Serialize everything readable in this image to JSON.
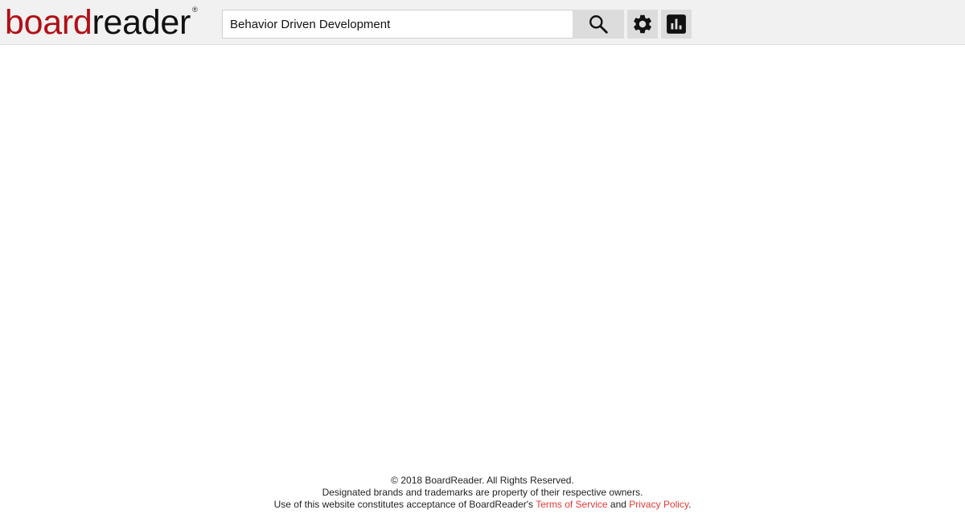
{
  "logo": {
    "part1": "board",
    "part2": "reader",
    "registered": "®"
  },
  "search": {
    "value": "Behavior Driven Development",
    "button_icon": "search-icon"
  },
  "toolbar": {
    "settings_icon": "gear-icon",
    "stats_icon": "bar-chart-icon"
  },
  "footer": {
    "copyright": "© 2018 BoardReader. All Rights Reserved.",
    "trademarks": "Designated brands and trademarks are property of their respective owners.",
    "acceptance_prefix": "Use of this website constitutes acceptance of BoardReader's",
    "terms_link": "Terms of Service",
    "and": "and",
    "privacy_link": "Privacy Policy",
    "suffix": "."
  },
  "colors": {
    "brand_red": "#b30e16",
    "link_red": "#e53935",
    "header_bg": "#f1f1f1",
    "button_bg": "#dcdcdc"
  }
}
